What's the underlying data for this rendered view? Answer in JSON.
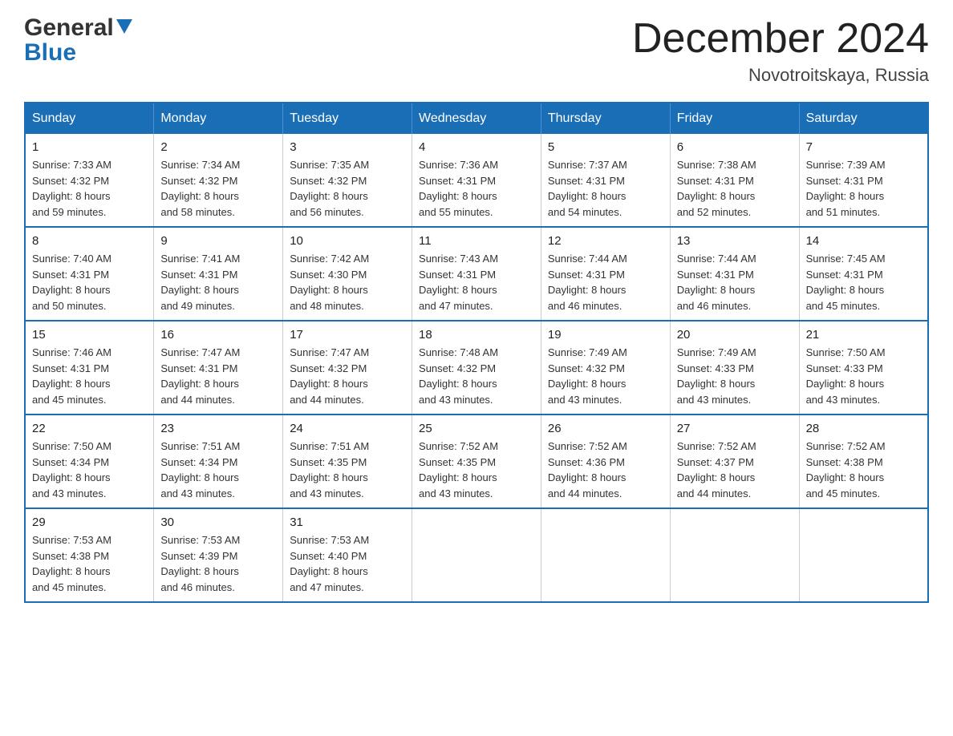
{
  "header": {
    "logo": {
      "line1": "General",
      "line2": "Blue"
    },
    "title": "December 2024",
    "location": "Novotroitskaya, Russia"
  },
  "weekdays": [
    "Sunday",
    "Monday",
    "Tuesday",
    "Wednesday",
    "Thursday",
    "Friday",
    "Saturday"
  ],
  "weeks": [
    [
      {
        "day": "1",
        "sunrise": "7:33 AM",
        "sunset": "4:32 PM",
        "daylight": "8 hours and 59 minutes."
      },
      {
        "day": "2",
        "sunrise": "7:34 AM",
        "sunset": "4:32 PM",
        "daylight": "8 hours and 58 minutes."
      },
      {
        "day": "3",
        "sunrise": "7:35 AM",
        "sunset": "4:32 PM",
        "daylight": "8 hours and 56 minutes."
      },
      {
        "day": "4",
        "sunrise": "7:36 AM",
        "sunset": "4:31 PM",
        "daylight": "8 hours and 55 minutes."
      },
      {
        "day": "5",
        "sunrise": "7:37 AM",
        "sunset": "4:31 PM",
        "daylight": "8 hours and 54 minutes."
      },
      {
        "day": "6",
        "sunrise": "7:38 AM",
        "sunset": "4:31 PM",
        "daylight": "8 hours and 52 minutes."
      },
      {
        "day": "7",
        "sunrise": "7:39 AM",
        "sunset": "4:31 PM",
        "daylight": "8 hours and 51 minutes."
      }
    ],
    [
      {
        "day": "8",
        "sunrise": "7:40 AM",
        "sunset": "4:31 PM",
        "daylight": "8 hours and 50 minutes."
      },
      {
        "day": "9",
        "sunrise": "7:41 AM",
        "sunset": "4:31 PM",
        "daylight": "8 hours and 49 minutes."
      },
      {
        "day": "10",
        "sunrise": "7:42 AM",
        "sunset": "4:30 PM",
        "daylight": "8 hours and 48 minutes."
      },
      {
        "day": "11",
        "sunrise": "7:43 AM",
        "sunset": "4:31 PM",
        "daylight": "8 hours and 47 minutes."
      },
      {
        "day": "12",
        "sunrise": "7:44 AM",
        "sunset": "4:31 PM",
        "daylight": "8 hours and 46 minutes."
      },
      {
        "day": "13",
        "sunrise": "7:44 AM",
        "sunset": "4:31 PM",
        "daylight": "8 hours and 46 minutes."
      },
      {
        "day": "14",
        "sunrise": "7:45 AM",
        "sunset": "4:31 PM",
        "daylight": "8 hours and 45 minutes."
      }
    ],
    [
      {
        "day": "15",
        "sunrise": "7:46 AM",
        "sunset": "4:31 PM",
        "daylight": "8 hours and 45 minutes."
      },
      {
        "day": "16",
        "sunrise": "7:47 AM",
        "sunset": "4:31 PM",
        "daylight": "8 hours and 44 minutes."
      },
      {
        "day": "17",
        "sunrise": "7:47 AM",
        "sunset": "4:32 PM",
        "daylight": "8 hours and 44 minutes."
      },
      {
        "day": "18",
        "sunrise": "7:48 AM",
        "sunset": "4:32 PM",
        "daylight": "8 hours and 43 minutes."
      },
      {
        "day": "19",
        "sunrise": "7:49 AM",
        "sunset": "4:32 PM",
        "daylight": "8 hours and 43 minutes."
      },
      {
        "day": "20",
        "sunrise": "7:49 AM",
        "sunset": "4:33 PM",
        "daylight": "8 hours and 43 minutes."
      },
      {
        "day": "21",
        "sunrise": "7:50 AM",
        "sunset": "4:33 PM",
        "daylight": "8 hours and 43 minutes."
      }
    ],
    [
      {
        "day": "22",
        "sunrise": "7:50 AM",
        "sunset": "4:34 PM",
        "daylight": "8 hours and 43 minutes."
      },
      {
        "day": "23",
        "sunrise": "7:51 AM",
        "sunset": "4:34 PM",
        "daylight": "8 hours and 43 minutes."
      },
      {
        "day": "24",
        "sunrise": "7:51 AM",
        "sunset": "4:35 PM",
        "daylight": "8 hours and 43 minutes."
      },
      {
        "day": "25",
        "sunrise": "7:52 AM",
        "sunset": "4:35 PM",
        "daylight": "8 hours and 43 minutes."
      },
      {
        "day": "26",
        "sunrise": "7:52 AM",
        "sunset": "4:36 PM",
        "daylight": "8 hours and 44 minutes."
      },
      {
        "day": "27",
        "sunrise": "7:52 AM",
        "sunset": "4:37 PM",
        "daylight": "8 hours and 44 minutes."
      },
      {
        "day": "28",
        "sunrise": "7:52 AM",
        "sunset": "4:38 PM",
        "daylight": "8 hours and 45 minutes."
      }
    ],
    [
      {
        "day": "29",
        "sunrise": "7:53 AM",
        "sunset": "4:38 PM",
        "daylight": "8 hours and 45 minutes."
      },
      {
        "day": "30",
        "sunrise": "7:53 AM",
        "sunset": "4:39 PM",
        "daylight": "8 hours and 46 minutes."
      },
      {
        "day": "31",
        "sunrise": "7:53 AM",
        "sunset": "4:40 PM",
        "daylight": "8 hours and 47 minutes."
      },
      null,
      null,
      null,
      null
    ]
  ],
  "labels": {
    "sunrise": "Sunrise: ",
    "sunset": "Sunset: ",
    "daylight": "Daylight: "
  }
}
